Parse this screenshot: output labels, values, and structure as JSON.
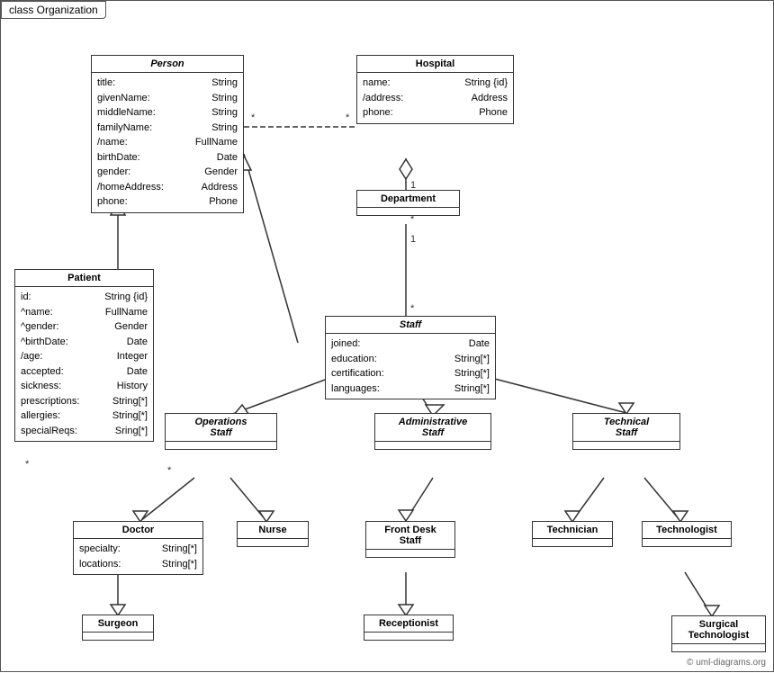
{
  "title": "class Organization",
  "classes": {
    "person": {
      "name": "Person",
      "italic": true,
      "attrs": [
        {
          "name": "title:",
          "type": "String"
        },
        {
          "name": "givenName:",
          "type": "String"
        },
        {
          "name": "middleName:",
          "type": "String"
        },
        {
          "name": "familyName:",
          "type": "String"
        },
        {
          "name": "/name:",
          "type": "FullName"
        },
        {
          "name": "birthDate:",
          "type": "Date"
        },
        {
          "name": "gender:",
          "type": "Gender"
        },
        {
          "name": "/homeAddress:",
          "type": "Address"
        },
        {
          "name": "phone:",
          "type": "Phone"
        }
      ]
    },
    "hospital": {
      "name": "Hospital",
      "italic": false,
      "attrs": [
        {
          "name": "name:",
          "type": "String {id}"
        },
        {
          "name": "/address:",
          "type": "Address"
        },
        {
          "name": "phone:",
          "type": "Phone"
        }
      ]
    },
    "department": {
      "name": "Department",
      "italic": false,
      "attrs": []
    },
    "staff": {
      "name": "Staff",
      "italic": true,
      "attrs": [
        {
          "name": "joined:",
          "type": "Date"
        },
        {
          "name": "education:",
          "type": "String[*]"
        },
        {
          "name": "certification:",
          "type": "String[*]"
        },
        {
          "name": "languages:",
          "type": "String[*]"
        }
      ]
    },
    "patient": {
      "name": "Patient",
      "italic": false,
      "attrs": [
        {
          "name": "id:",
          "type": "String {id}"
        },
        {
          "name": "^name:",
          "type": "FullName"
        },
        {
          "name": "^gender:",
          "type": "Gender"
        },
        {
          "name": "^birthDate:",
          "type": "Date"
        },
        {
          "name": "/age:",
          "type": "Integer"
        },
        {
          "name": "accepted:",
          "type": "Date"
        },
        {
          "name": "sickness:",
          "type": "History"
        },
        {
          "name": "prescriptions:",
          "type": "String[*]"
        },
        {
          "name": "allergies:",
          "type": "String[*]"
        },
        {
          "name": "specialReqs:",
          "type": "Sring[*]"
        }
      ]
    },
    "opsStaff": {
      "name": "Operations\nStaff",
      "italic": true,
      "attrs": []
    },
    "adminStaff": {
      "name": "Administrative\nStaff",
      "italic": true,
      "attrs": []
    },
    "techStaff": {
      "name": "Technical\nStaff",
      "italic": true,
      "attrs": []
    },
    "doctor": {
      "name": "Doctor",
      "italic": false,
      "attrs": [
        {
          "name": "specialty:",
          "type": "String[*]"
        },
        {
          "name": "locations:",
          "type": "String[*]"
        }
      ]
    },
    "nurse": {
      "name": "Nurse",
      "italic": false,
      "attrs": []
    },
    "frontDesk": {
      "name": "Front Desk\nStaff",
      "italic": false,
      "attrs": []
    },
    "technician": {
      "name": "Technician",
      "italic": false,
      "attrs": []
    },
    "technologist": {
      "name": "Technologist",
      "italic": false,
      "attrs": []
    },
    "surgeon": {
      "name": "Surgeon",
      "italic": false,
      "attrs": []
    },
    "receptionist": {
      "name": "Receptionist",
      "italic": false,
      "attrs": []
    },
    "surgicalTech": {
      "name": "Surgical\nTechnologist",
      "italic": false,
      "attrs": []
    }
  },
  "copyright": "© uml-diagrams.org"
}
